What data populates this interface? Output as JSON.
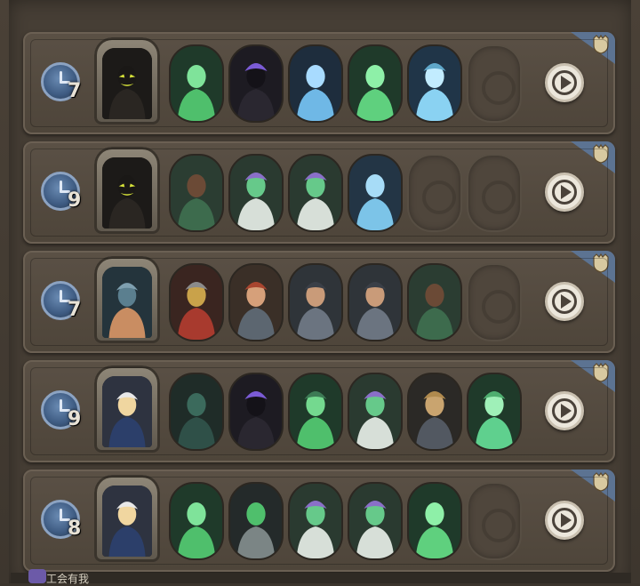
{
  "colors": {
    "panel_bg": "#463e35",
    "row_bg": "#5a5045",
    "timer_blue": "#3e5b82",
    "ghost_green": "#4fbf6c",
    "ghost_blue": "#6fb8e6",
    "corner_blue": "#5c7392"
  },
  "rows": [
    {
      "timer": "7",
      "boss": "dark-tree-boss",
      "heroes": [
        "green-elf-hero",
        "hooded-rogue-hero",
        "frost-beast-hero",
        "green-brute-hero",
        "ice-knight-hero",
        "empty-slot"
      ]
    },
    {
      "timer": "9",
      "boss": "dark-tree-boss",
      "heroes": [
        "water-mage-hero",
        "green-bride-hero",
        "green-bride-hero",
        "ice-archer-hero",
        "empty-slot",
        "empty-slot"
      ]
    },
    {
      "timer": "7",
      "boss": "sea-queen-boss",
      "heroes": [
        "red-knight-hero",
        "bearded-warrior-hero",
        "shield-maiden-hero",
        "shield-maiden-hero",
        "water-mage-hero",
        "empty-slot"
      ]
    },
    {
      "timer": "9",
      "boss": "sailor-girl-boss",
      "heroes": [
        "tentacle-beast-hero",
        "hooded-rogue-hero",
        "ghost-swordsman-hero",
        "green-bride-hero",
        "card-dealer-hero",
        "ghost-king-hero"
      ]
    },
    {
      "timer": "8",
      "boss": "sailor-girl-boss",
      "heroes": [
        "green-elf-hero",
        "shield-ghost-hero",
        "green-bride-hero",
        "green-bride-hero",
        "green-brute-hero",
        "empty-slot"
      ]
    }
  ],
  "bottom": {
    "label": "工会有我"
  }
}
